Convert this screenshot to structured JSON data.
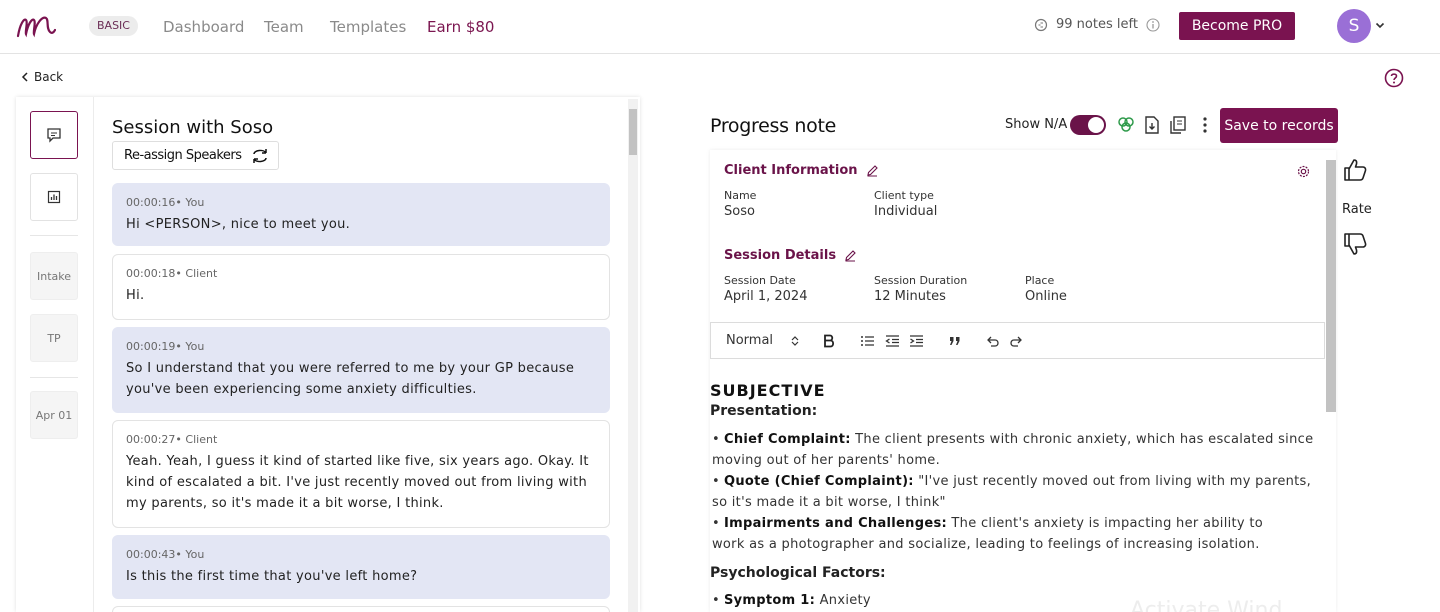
{
  "nav": {
    "plan_badge": "BASIC",
    "links": [
      "Dashboard",
      "Team",
      "Templates",
      "Earn $80"
    ],
    "notes_left": "99 notes left",
    "become_pro": "Become PRO",
    "avatar_initial": "S"
  },
  "back_label": "Back",
  "transcript": {
    "title": "Session with Soso",
    "reassign_label": "Re-assign Speakers",
    "rail": [
      "Intake",
      "TP",
      "Apr 01"
    ],
    "messages": [
      {
        "time": "00:00:16",
        "speaker": "You",
        "text": "Hi <PERSON>, nice to meet you."
      },
      {
        "time": "00:00:18",
        "speaker": "Client",
        "text": "Hi."
      },
      {
        "time": "00:00:19",
        "speaker": "You",
        "text": "So I understand that you were referred to me by your GP because you've been experiencing some anxiety difficulties."
      },
      {
        "time": "00:00:27",
        "speaker": "Client",
        "text": "Yeah. Yeah, I guess it kind of started like five, six years ago. Okay. It kind of escalated a bit. I've just recently moved out from living with my parents, so it's made it a bit worse, I think."
      },
      {
        "time": "00:00:43",
        "speaker": "You",
        "text": "Is this the first time that you've left home?"
      }
    ]
  },
  "note": {
    "title": "Progress note",
    "show_na_label": "Show N/A",
    "save_label": "Save to records",
    "client_info_head": "Client Information",
    "name_label": "Name",
    "name_value": "Soso",
    "client_type_label": "Client type",
    "client_type_value": "Individual",
    "session_head": "Session Details",
    "date_label": "Session Date",
    "date_value": "April 1, 2024",
    "duration_label": "Session Duration",
    "duration_value": "12 Minutes",
    "place_label": "Place",
    "place_value": "Online",
    "format_select": "Normal",
    "subjective": "SUBJECTIVE",
    "presentation": "Presentation:",
    "bullets": [
      {
        "label": "Chief Complaint:",
        "text": " The client presents with chronic anxiety, which has escalated since moving out of her parents' home."
      },
      {
        "label": "Quote (Chief Complaint):",
        "text": " \"I've just recently moved out from living with my parents, so it's made it a bit worse, I think\""
      },
      {
        "label": "Impairments and Challenges:",
        "text": " The client's anxiety is impacting her ability to work as a photographer and socialize, leading to feelings of increasing isolation."
      }
    ],
    "psych_factors": "Psychological Factors:",
    "symptom": {
      "label": "Symptom 1:",
      "text": " Anxiety"
    }
  },
  "rate_label": "Rate",
  "watermark": "Activate Wind",
  "colors": {
    "brand": "#7a1350",
    "you_bubble": "#e3e6f4"
  }
}
